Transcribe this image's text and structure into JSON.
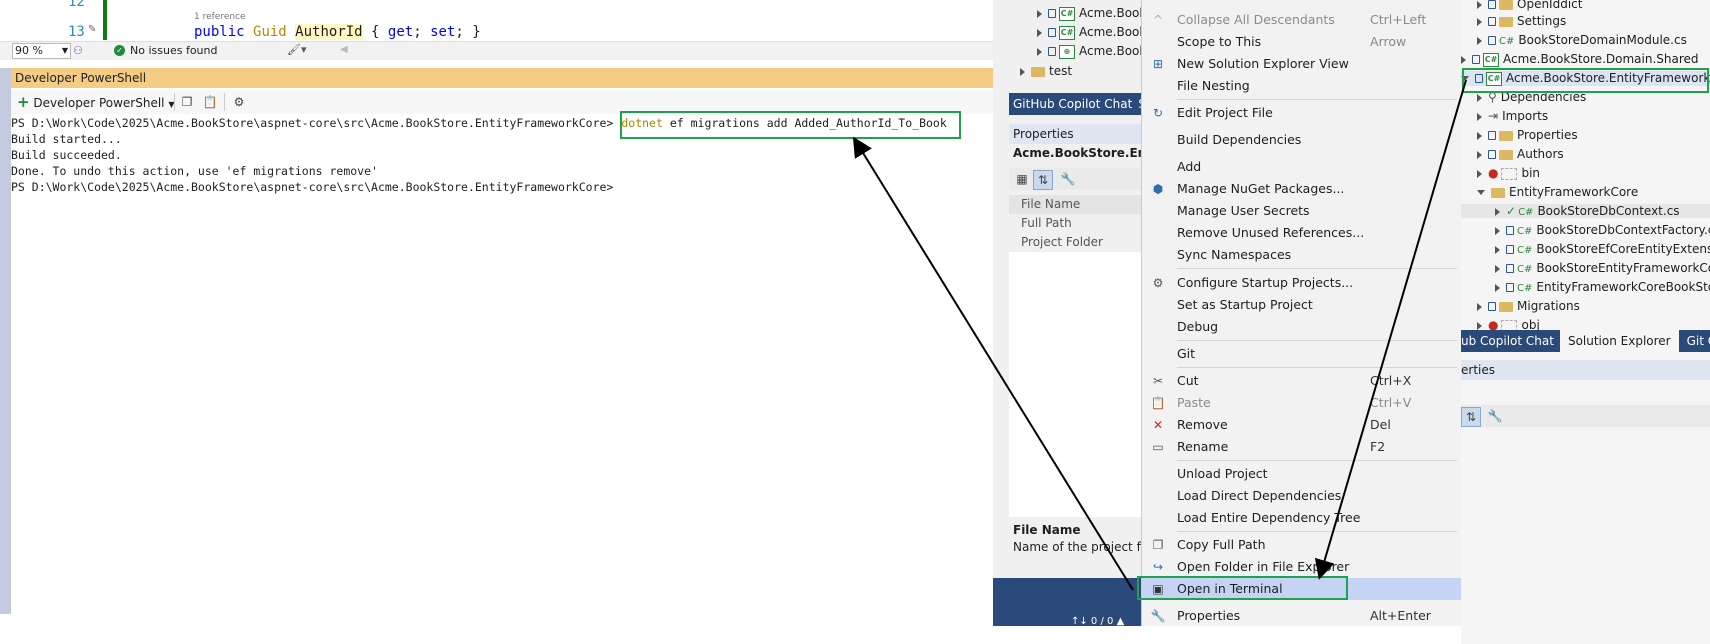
{
  "editor": {
    "line_12": "12",
    "line_13": "13",
    "codelens": "1 reference",
    "code_public": "public",
    "code_type": "Guid",
    "code_name": "AuthorId",
    "code_rest_open": "{",
    "code_get": "get",
    "code_set": "set",
    "code_rest_close": "}",
    "zoom": "90 %",
    "issues": "No issues found"
  },
  "terminal": {
    "header": "Developer PowerShell",
    "toolbar_dropdown": "Developer PowerShell",
    "prompt1": "PS D:\\Work\\Code\\2025\\Acme.BookStore\\aspnet-core\\src\\Acme.BookStore.EntityFrameworkCore>",
    "cmd_dotnet": "dotnet",
    "cmd_rest": " ef migrations add Added_AuthorId_To_Book",
    "out1": "Build started...",
    "out2": "Build succeeded.",
    "out3": "Done. To undo this action, use 'ef migrations remove'",
    "prompt2": "PS D:\\Work\\Code\\2025\\Acme.BookStore\\aspnet-core\\src\\Acme.BookStore.EntityFrameworkCore>"
  },
  "middle_panel": {
    "items": [
      "Acme.Book",
      "Acme.Book",
      "Acme.Book"
    ],
    "test_folder": "test",
    "tab_copilot": "GitHub Copilot Chat",
    "tab_se": "So",
    "properties_title": "Properties",
    "project_name": "Acme.BookStore.Entity",
    "props": [
      "File Name",
      "Full Path",
      "Project Folder"
    ],
    "desc_title": "File Name",
    "desc_text": "Name of the project file.",
    "status": "↑↓ 0 / 0 ▲"
  },
  "context_menu": {
    "items": [
      {
        "label": "Collapse All Descendants",
        "shortcut": "Ctrl+Left Arrow",
        "disabled": true
      },
      {
        "label": "Scope to This"
      },
      {
        "label": "New Solution Explorer View"
      },
      {
        "label": "File Nesting"
      },
      {
        "label": "Edit Project File"
      },
      {
        "label": "Build Dependencies"
      },
      {
        "label": "Add"
      },
      {
        "label": "Manage NuGet Packages..."
      },
      {
        "label": "Manage User Secrets"
      },
      {
        "label": "Remove Unused References..."
      },
      {
        "label": "Sync Namespaces"
      },
      {
        "label": "Configure Startup Projects..."
      },
      {
        "label": "Set as Startup Project"
      },
      {
        "label": "Debug"
      },
      {
        "label": "Git"
      },
      {
        "label": "Cut",
        "shortcut": "Ctrl+X"
      },
      {
        "label": "Paste",
        "shortcut": "Ctrl+V",
        "disabled": true
      },
      {
        "label": "Remove",
        "shortcut": "Del"
      },
      {
        "label": "Rename",
        "shortcut": "F2"
      },
      {
        "label": "Unload Project"
      },
      {
        "label": "Load Direct Dependencies"
      },
      {
        "label": "Load Entire Dependency Tree"
      },
      {
        "label": "Copy Full Path"
      },
      {
        "label": "Open Folder in File Explorer"
      },
      {
        "label": "Open in Terminal"
      },
      {
        "label": "Properties",
        "shortcut": "Alt+Enter"
      }
    ]
  },
  "solution_explorer": {
    "rows": [
      "OpenIddict",
      "Settings",
      "BookStoreDomainModule.cs",
      "Acme.BookStore.Domain.Shared",
      "Acme.BookStore.EntityFrameworkCore",
      "Dependencies",
      "Imports",
      "Properties",
      "Authors",
      "bin",
      "EntityFrameworkCore",
      "BookStoreDbContext.cs",
      "BookStoreDbContextFactory.cs",
      "BookStoreEfCoreEntityExtension",
      "BookStoreEntityFrameworkCoreM",
      "EntityFrameworkCoreBookStoreD",
      "Migrations",
      "obj"
    ],
    "tabs": [
      "ub Copilot Chat",
      "Solution Explorer",
      "Git Chang"
    ],
    "properties_label": "erties"
  }
}
